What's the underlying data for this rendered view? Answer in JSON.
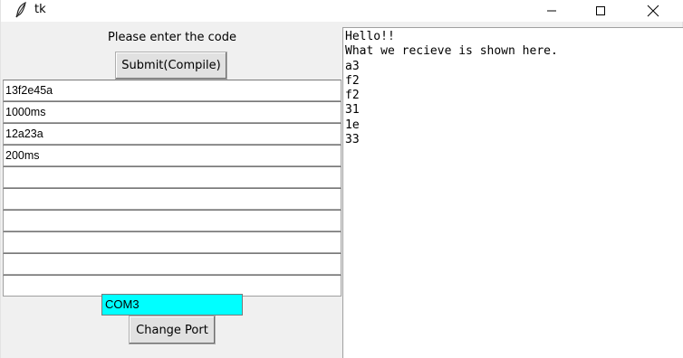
{
  "window": {
    "title": "tk"
  },
  "left_panel": {
    "prompt": "Please enter the code",
    "submit_label": "Submit(Compile)",
    "entries": [
      "13f2e45a",
      "1000ms",
      "12a23a",
      "200ms",
      "",
      "",
      "",
      "",
      "",
      ""
    ],
    "port_value": "COM3",
    "change_port_label": "Change Port"
  },
  "output": {
    "lines": [
      "Hello!!",
      "What we recieve is shown here.",
      "a3",
      "f2",
      "f2",
      "31",
      "1e",
      "33"
    ]
  },
  "colors": {
    "port_field_bg": "#00ffff",
    "window_bg": "#f0f0f0"
  }
}
